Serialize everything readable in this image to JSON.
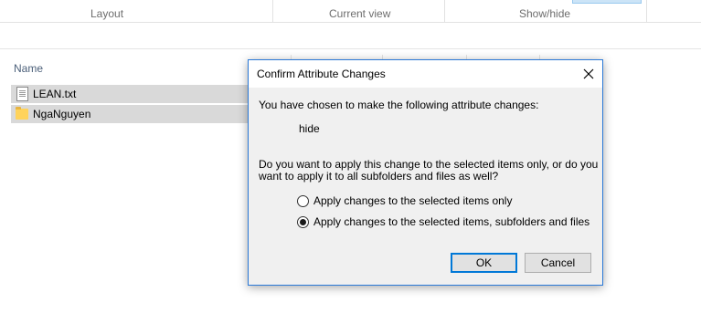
{
  "ribbon": {
    "groups": [
      "Layout",
      "Current view",
      "Show/hide"
    ]
  },
  "file_list": {
    "column_name": "Name",
    "items": [
      {
        "name": "LEAN.txt",
        "icon": "text-file-icon"
      },
      {
        "name": "NgaNguyen",
        "icon": "folder-icon"
      }
    ]
  },
  "dialog": {
    "title": "Confirm Attribute Changes",
    "intro": "You have chosen to make the following attribute changes:",
    "change": "hide",
    "question_line1": "Do you want to apply this change to the selected items only, or do you",
    "question_line2": "want to apply it to all subfolders and files as well?",
    "options": [
      {
        "label": "Apply changes to the selected items only",
        "checked": false
      },
      {
        "label": "Apply changes to the selected items, subfolders and files",
        "checked": true
      }
    ],
    "ok_label": "OK",
    "cancel_label": "Cancel"
  },
  "colors": {
    "dialog_border": "#2b79d7",
    "default_button_border": "#0078d7",
    "selection_bg": "#d9d9d9"
  }
}
